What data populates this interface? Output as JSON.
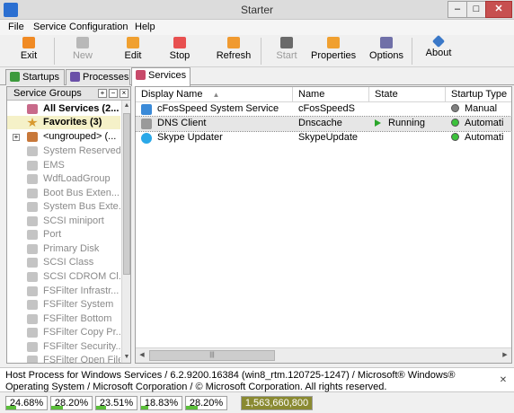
{
  "window": {
    "title": "Starter",
    "min_glyph": "–",
    "max_glyph": "□",
    "close_glyph": "✕"
  },
  "menu": [
    "File",
    "Service",
    "Configuration",
    "Help"
  ],
  "toolbar": {
    "exit": "Exit",
    "new": "New",
    "edit": "Edit",
    "stop": "Stop",
    "refresh": "Refresh",
    "start": "Start",
    "properties": "Properties",
    "options": "Options",
    "about": "About"
  },
  "tabs": [
    "Startups",
    "Processes",
    "Services"
  ],
  "groups": {
    "header": "Service Groups",
    "items": [
      "All Services (2...",
      "Favorites (3)",
      "<ungrouped> (...",
      "System Reserved",
      "EMS",
      "WdfLoadGroup",
      "Boot Bus Exten...",
      "System Bus Exte...",
      "SCSI miniport",
      "Port",
      "Primary Disk",
      "SCSI Class",
      "SCSI CDROM Cl...",
      "FSFilter Infrastr...",
      "FSFilter System",
      "FSFilter Bottom",
      "FSFilter Copy Pr...",
      "FSFilter Security...",
      "FSFilter Open File"
    ]
  },
  "list": {
    "columns": [
      "Display Name",
      "Name",
      "State",
      "Startup Type"
    ],
    "rows": [
      {
        "display": "cFosSpeed System Service",
        "name": "cFosSpeedS",
        "state": "",
        "startup": "Manual"
      },
      {
        "display": "DNS Client",
        "name": "Dnscache",
        "state": "Running",
        "startup": "Automati"
      },
      {
        "display": "Skype Updater",
        "name": "SkypeUpdate",
        "state": "",
        "startup": "Automati"
      }
    ]
  },
  "info": "Host Process for Windows Services / 6.2.9200.16384 (win8_rtm.120725-1247) / Microsoft® Windows® Operating System / Microsoft Corporation / © Microsoft Corporation. All rights reserved.",
  "status": {
    "cpu": [
      {
        "label": "24.68%",
        "level": 0.2468
      },
      {
        "label": "28.20%",
        "level": 0.282
      },
      {
        "label": "23.51%",
        "level": 0.2351
      },
      {
        "label": "18.83%",
        "level": 0.1883
      },
      {
        "label": "28.20%",
        "level": 0.282
      }
    ],
    "memory": "1,563,660,800"
  },
  "colors": {
    "accent_selected": "#f5f1c8",
    "running": "#2aa52a",
    "manual": "#808080",
    "automatic": "#3cc23c"
  }
}
